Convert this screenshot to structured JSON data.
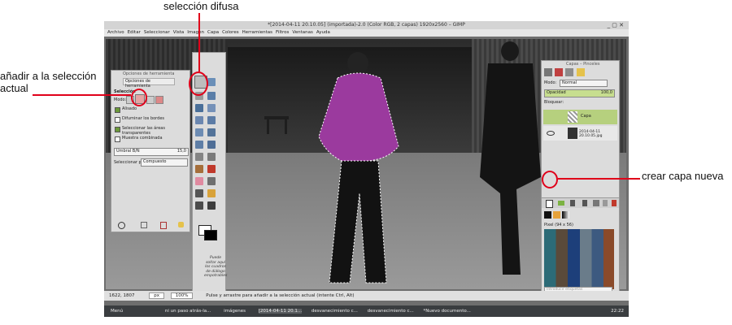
{
  "annotations": {
    "top": "selección difusa",
    "left_line1": "añadir a la selección",
    "left_line2": "actual",
    "right": "crear capa nueva"
  },
  "window": {
    "title": "*[2014-04-11 20.10.05] (importada)-2.0 (Color RGB, 2 capas) 1920x2560 – GIMP",
    "controls": "_ ▢ ✕"
  },
  "menubar": [
    "Archivo",
    "Editar",
    "Seleccionar",
    "Vista",
    "Imagen",
    "Capa",
    "Colores",
    "Herramientas",
    "Filtros",
    "Ventanas",
    "Ayuda"
  ],
  "tool_options": {
    "panel_title": "Opciones de herramienta",
    "tab_label": "Opciones de herramienta",
    "section": "Selección",
    "mode_label": "Modo:",
    "checkboxes": [
      {
        "label": "Alisado",
        "checked": true
      },
      {
        "label": "Difuminar los bordes",
        "checked": false
      },
      {
        "label": "Seleccionar las áreas transparentes",
        "checked": true
      },
      {
        "label": "Muestra combinada",
        "checked": false
      }
    ],
    "threshold_label": "Umbral B/N",
    "threshold_value": "15,0",
    "select_by_label": "Seleccionar por",
    "select_by_value": "Compuesto"
  },
  "toolbox": {
    "dock_text": "Puede soltar aquí los cuadros de diálogo empotrables"
  },
  "layers": {
    "panel_title": "Capas – Pinceles",
    "mode_label": "Modo:",
    "mode_value": "Normal",
    "opacity_label": "Opacidad",
    "opacity_value": "100,0",
    "lock_label": "Bloquear:",
    "items": [
      "Capa",
      "2014-04-11 20.10.05.jpg"
    ],
    "brushes_label": "Pixel (94 x 56)",
    "brushes_tag": "Introducir etiquetas"
  },
  "status": {
    "coords": "1622, 1807",
    "unit": "px",
    "zoom": "100%",
    "message": "Pulse y arrastre para añadir a la selección actual (intente Ctrl, Alt)"
  },
  "taskbar": {
    "menu": "Menú",
    "items": [
      "ni un paso atrás-la...",
      "imágenes",
      "[2014-04-11 20.1...",
      "desvanecimiento c...",
      "desvanecimiento c...",
      "*Nuevo documento..."
    ],
    "clock": "22:22"
  },
  "colors": {
    "callout": "#e0001a",
    "shirt": "#9b3a9e",
    "layer_selected": "#b6d07e"
  }
}
